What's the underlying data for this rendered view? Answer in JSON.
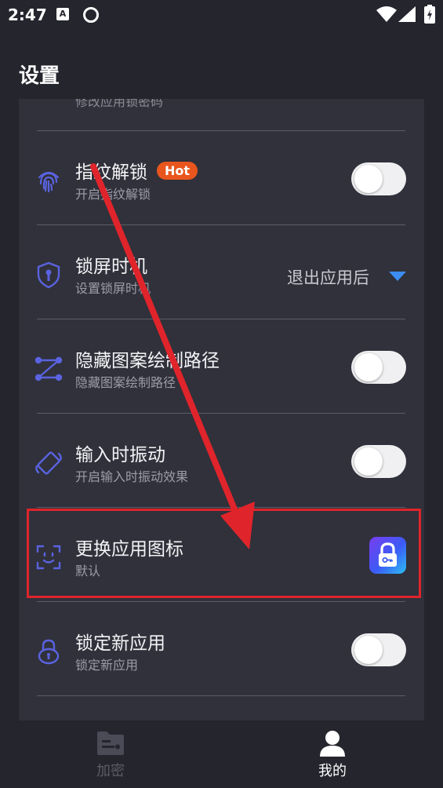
{
  "status_bar": {
    "time": "2:47",
    "notification_glyph": "A"
  },
  "header": {
    "title": "设置"
  },
  "card": {
    "cut_off_label": "修改应用锁密码",
    "rows": [
      {
        "title": "指纹解锁",
        "badge": "Hot",
        "subtitle": "开启指纹解锁",
        "icon": "fingerprint-icon",
        "control": "toggle",
        "enabled": false
      },
      {
        "title": "锁屏时机",
        "subtitle": "设置锁屏时机",
        "icon": "shield-key-icon",
        "control": "dropdown",
        "value": "退出应用后"
      },
      {
        "title": "隐藏图案绘制路径",
        "subtitle": "隐藏图案绘制路径",
        "icon": "pattern-path-icon",
        "control": "toggle",
        "enabled": false
      },
      {
        "title": "输入时振动",
        "subtitle": "开启输入时振动效果",
        "icon": "vibration-icon",
        "control": "toggle",
        "enabled": false
      },
      {
        "title": "更换应用图标",
        "subtitle": "默认",
        "icon": "face-scan-icon",
        "control": "app-icon-preview"
      },
      {
        "title": "锁定新应用",
        "subtitle": "锁定新应用",
        "icon": "padlock-icon",
        "control": "toggle",
        "enabled": false
      }
    ]
  },
  "bottom_nav": {
    "items": [
      {
        "label": "加密",
        "icon": "encrypt-folder-icon",
        "active": false
      },
      {
        "label": "我的",
        "icon": "profile-icon",
        "active": true
      }
    ]
  },
  "colors": {
    "background": "#24252d",
    "card": "#30313b",
    "accent": "#4f5bd5",
    "hot_badge": "#e8561e",
    "annotation": "#e0242b"
  }
}
